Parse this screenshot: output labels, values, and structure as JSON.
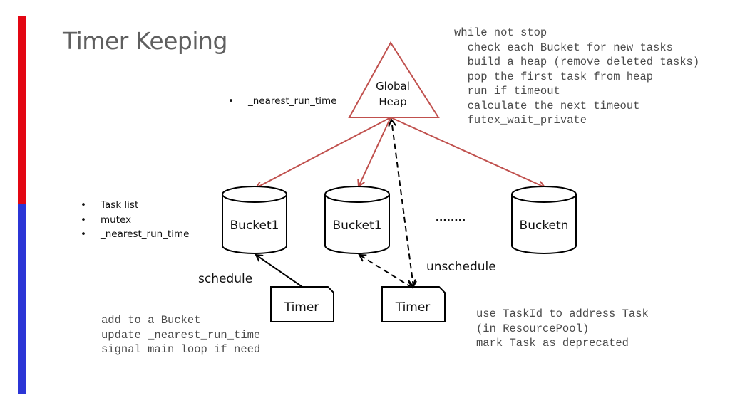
{
  "slide": {
    "title": "Timer Keeping",
    "accent_colors": {
      "bar_top": "#e30613",
      "bar_bottom": "#2b35d6",
      "heap_stroke": "#c0504d",
      "line": "#000000"
    }
  },
  "global_heap": {
    "label_line1": "Global",
    "label_line2": "Heap",
    "fields": [
      "_nearest_run_time"
    ]
  },
  "main_loop_code": [
    "while not stop",
    "  check each Bucket for new tasks",
    "  build a heap (remove deleted tasks)",
    "  pop the first task from heap",
    "  run if timeout",
    "  calculate the next timeout",
    "  futex_wait_private"
  ],
  "bucket_fields": [
    "Task list",
    "mutex",
    "_nearest_run_time"
  ],
  "buckets": [
    {
      "label": "Bucket1"
    },
    {
      "label": "Bucket1"
    },
    {
      "label": "Bucketn"
    }
  ],
  "ellipsis": "........",
  "timers": [
    {
      "label": "Timer"
    },
    {
      "label": "Timer"
    }
  ],
  "actions": {
    "schedule": {
      "label": "schedule",
      "steps": [
        "add to a Bucket",
        "update _nearest_run_time",
        "signal main loop if need"
      ]
    },
    "unschedule": {
      "label": "unschedule",
      "steps": [
        "use TaskId to address Task",
        "(in ResourcePool)",
        "mark Task as deprecated"
      ]
    }
  },
  "bullet_glyph": "•"
}
